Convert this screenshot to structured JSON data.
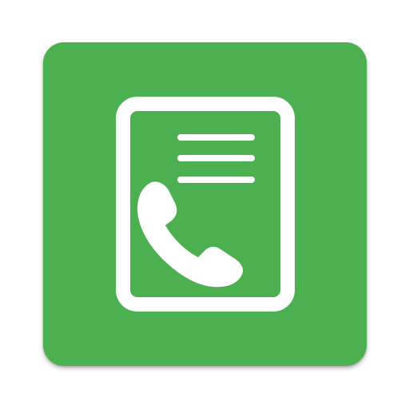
{
  "app_icon": {
    "icon": "phone-directory-icon",
    "colors": {
      "background": "#4caf50",
      "foreground": "#ffffff"
    }
  }
}
